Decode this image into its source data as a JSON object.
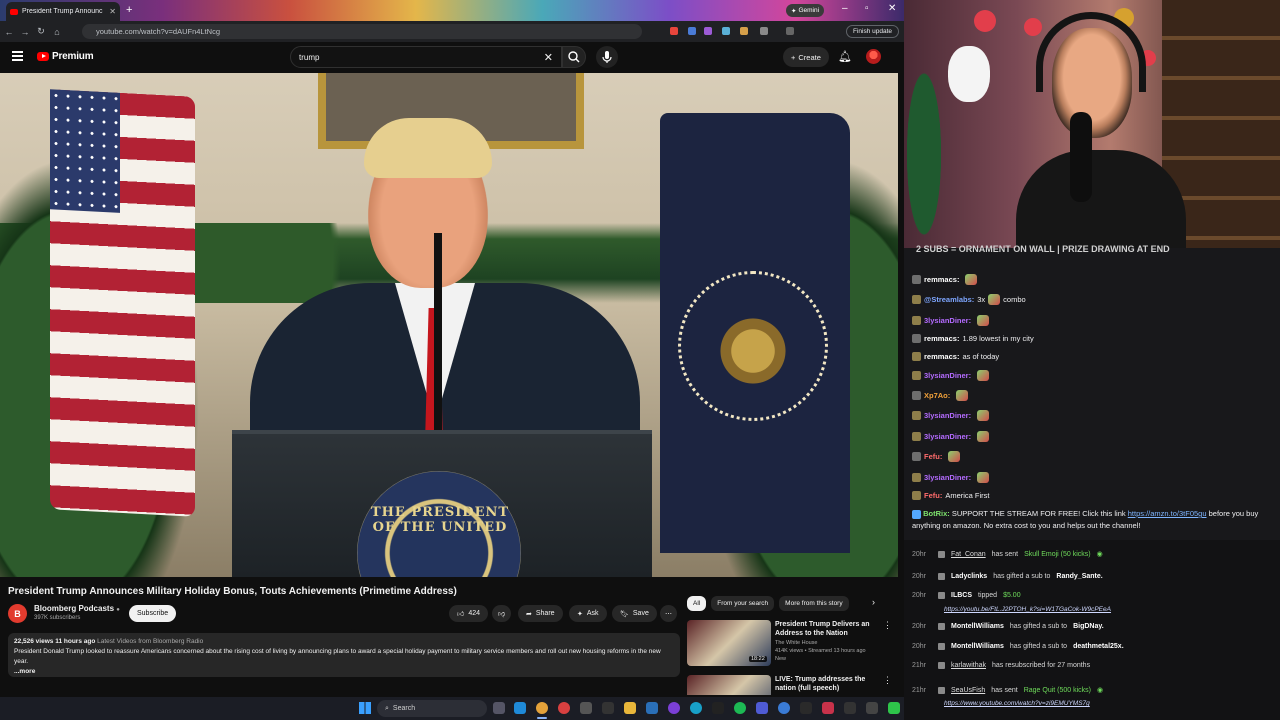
{
  "browser": {
    "tab_title": "President Trump Announc",
    "url": "youtube.com/watch?v=dAUFn4LtNcg",
    "gemini_label": "Gemini",
    "finish_update_label": "Finish update"
  },
  "youtube": {
    "brand": "Premium",
    "search_value": "trump",
    "create_label": "Create",
    "video": {
      "title": "President Trump Announces Military Holiday Bonus, Touts Achievements (Primetime Address)",
      "podium_text": "THE PRESIDENT OF THE UNITED"
    },
    "channel": {
      "avatar_letter": "B",
      "name": "Bloomberg Podcasts",
      "subscribers": "397K subscribers",
      "subscribe_label": "Subscribe"
    },
    "actions": {
      "likes": "424",
      "share": "Share",
      "ask": "Ask",
      "save": "Save"
    },
    "description": {
      "views": "22,526 views",
      "time": "11 hours ago",
      "tags": "Latest Videos from Bloomberg Radio",
      "text": "President Donald Trump looked to reassure Americans concerned about the rising cost of living by announcing plans to award a special holiday payment to military service members and roll out new housing reforms in the new year.",
      "more": "...more"
    },
    "chips": [
      "All",
      "From your search",
      "More from this story"
    ],
    "recommendations": [
      {
        "title": "President Trump Delivers an Address to the Nation",
        "channel": "The White House",
        "stats": "414K views • Streamed 13 hours ago",
        "badge": "New",
        "duration": "18:22"
      },
      {
        "title": "LIVE: Trump addresses the nation (full speech)",
        "channel": "",
        "stats": "",
        "badge": "",
        "duration": ""
      }
    ]
  },
  "chat": {
    "banner": "2 SUBS = ORNAMENT ON WALL | PRIZE DRAWING AT END",
    "messages": [
      {
        "user": "remmacs:",
        "color": "#ffffff",
        "text": ""
      },
      {
        "user": "@Streamlabs:",
        "color": "#7ea6ff",
        "text": "3x",
        "extra": "combo"
      },
      {
        "user": "3lysianDiner:",
        "color": "#b46bff",
        "text": ""
      },
      {
        "user": "remmacs:",
        "color": "#ffffff",
        "text": "1.89 lowest in my city"
      },
      {
        "user": "remmacs:",
        "color": "#ffffff",
        "text": "as of today"
      },
      {
        "user": "3lysianDiner:",
        "color": "#b46bff",
        "text": ""
      },
      {
        "user": "Xp7Ao:",
        "color": "#f2a13a",
        "text": ""
      },
      {
        "user": "3lysianDiner:",
        "color": "#b46bff",
        "text": ""
      },
      {
        "user": "3lysianDiner:",
        "color": "#b46bff",
        "text": ""
      },
      {
        "user": "Fefu:",
        "color": "#ff6b6b",
        "text": ""
      },
      {
        "user": "3lysianDiner:",
        "color": "#b46bff",
        "text": ""
      },
      {
        "user": "Fefu:",
        "color": "#ff6b6b",
        "text": "America First"
      }
    ],
    "botrix": {
      "user": "BotRix:",
      "text": "SUPPORT THE STREAM FOR FREE! Click this link",
      "link": "https://amzn.to/3tF05gu",
      "text2": "before you buy anything on amazon. No extra cost to you and helps out the channel!"
    },
    "events": [
      {
        "time": "20hr",
        "name": "Fat_Conan",
        "action": "has sent",
        "detail": "Skull Emoji (50 kicks)",
        "kind": "kick"
      },
      {
        "time": "20hr",
        "name": "Ladyclinks",
        "action": "has gifted a sub to",
        "detail": "Randy_Sante.",
        "kind": "gift"
      },
      {
        "time": "20hr",
        "name": "ILBCS",
        "action": "tipped",
        "detail": "$5.00",
        "kind": "tip",
        "link": "https://youtu.be/FtL.J2PTOH_k?si=W1TGaCok-W9cPEeA"
      },
      {
        "time": "20hr",
        "name": "MontellWilliams",
        "action": "has gifted a sub to",
        "detail": "BigDNay.",
        "kind": "gift"
      },
      {
        "time": "20hr",
        "name": "MontellWilliams",
        "action": "has gifted a sub to",
        "detail": "deathmetal25x.",
        "kind": "gift"
      },
      {
        "time": "21hr",
        "name": "karlawithak",
        "action": "has resubscribed for 27 months",
        "detail": "",
        "kind": "resub"
      },
      {
        "time": "21hr",
        "name": "SeaUsFish",
        "action": "has sent",
        "detail": "Rage Quit (500 kicks)",
        "kind": "kick",
        "link": "https://www.youtube.com/watch?v=zi9EMUYMS7g"
      }
    ]
  },
  "taskbar": {
    "search_label": "Search"
  }
}
